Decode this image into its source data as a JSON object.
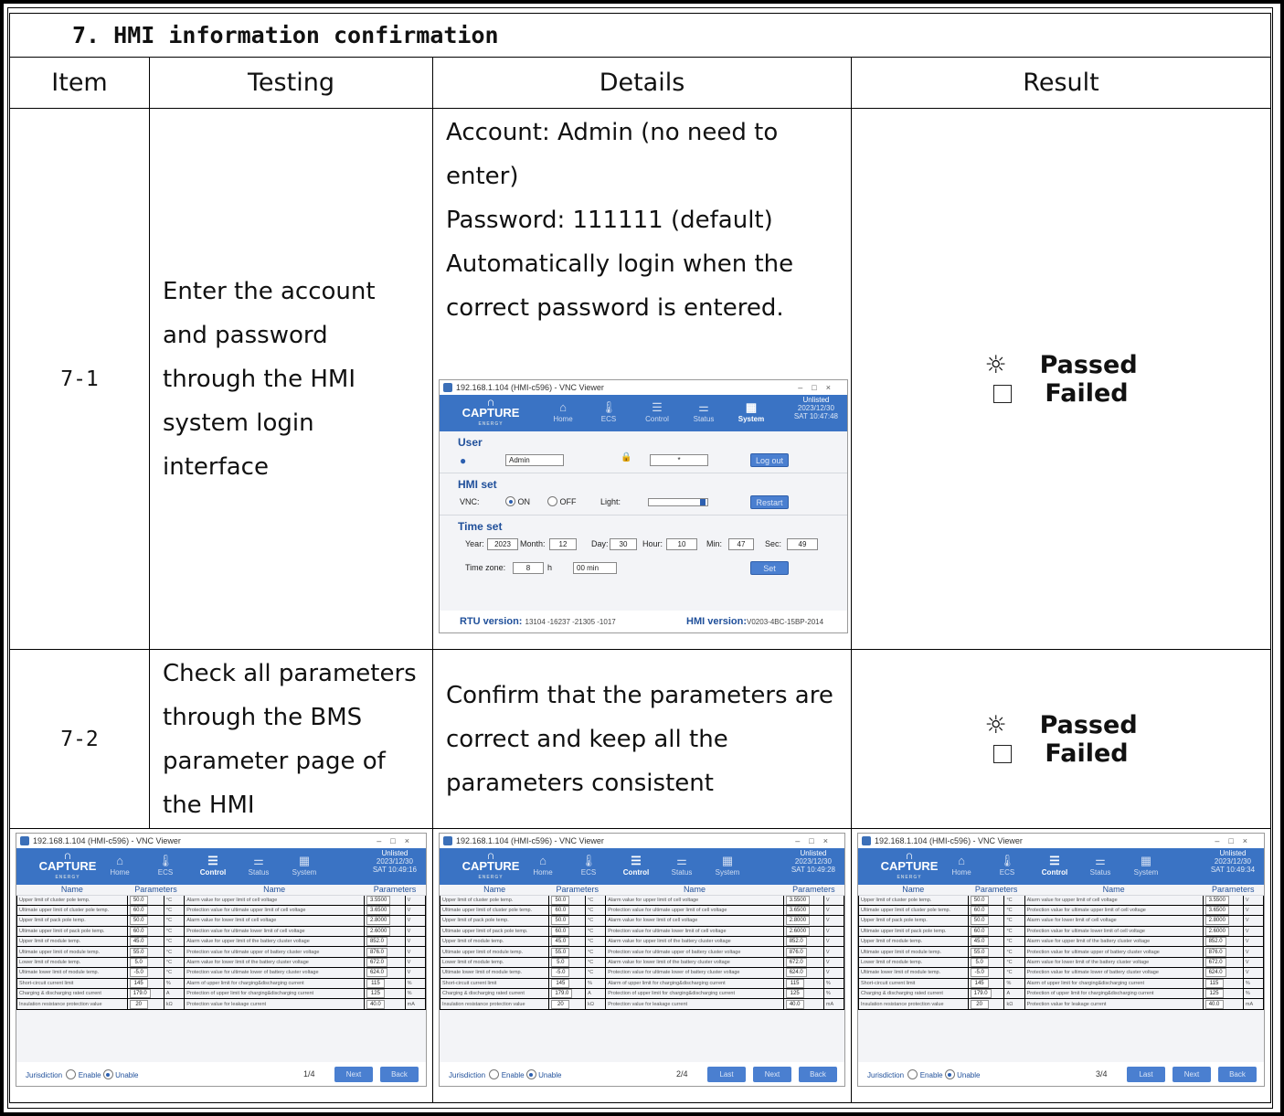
{
  "section_title": "7. HMI information confirmation",
  "headers": {
    "item": "Item",
    "testing": "Testing",
    "details": "Details",
    "result": "Result"
  },
  "rows": [
    {
      "item": "7-1",
      "testing": "Enter the account and password through the HMI system login interface",
      "details": [
        "Account: Admin (no need to",
        "enter)",
        "Password: 111111 (default)",
        "Automatically login when the",
        "correct password is entered."
      ],
      "passed": "Passed",
      "failed": "Failed"
    },
    {
      "item": "7-2",
      "testing": "Check all parameters through the BMS parameter page of the HMI",
      "details": [
        "Confirm that the parameters are",
        "correct and keep all the",
        "parameters consistent"
      ],
      "passed": "Passed",
      "failed": "Failed"
    }
  ],
  "vnc": {
    "window_title": "192.168.1.104 (HMI-c596) - VNC Viewer",
    "logo": "CAPTURE",
    "logo_sub": "ENERGY",
    "nav": [
      "Home",
      "ECS",
      "Control",
      "Status",
      "System"
    ],
    "login_screen": {
      "status": "Unlisted",
      "date": "2023/12/30",
      "time": "SAT  10:47:48",
      "user_heading": "User",
      "account": "Admin",
      "password_mask": "*",
      "logout": "Log out",
      "hmi_heading": "HMI set",
      "vnc_label": "VNC:",
      "on": "ON",
      "off": "OFF",
      "light": "Light:",
      "restart": "Restart",
      "time_heading": "Time set",
      "year_label": "Year:",
      "year": "2023",
      "month_label": "Month:",
      "month": "12",
      "day_label": "Day:",
      "day": "30",
      "hour_label": "Hour:",
      "hour": "10",
      "min_label": "Min:",
      "min": "47",
      "sec_label": "Sec:",
      "sec": "49",
      "tz_label": "Time zone:",
      "tz": "8",
      "tz_unit": "h",
      "tz_min": "00  min",
      "set": "Set",
      "rtu_label": "RTU version:",
      "rtu": "13104 -16237 -21305 -1017",
      "hmi_label": "HMI version:",
      "hmi": "V0203-4BC-15BP-2014"
    },
    "param_screens": [
      {
        "status": "Unlisted",
        "date": "2023/12/30",
        "time": "SAT  10:49:16",
        "page": "1/4",
        "buttons": [
          "Next",
          "Back"
        ]
      },
      {
        "status": "Unlisted",
        "date": "2023/12/30",
        "time": "SAT  10:49:28",
        "page": "2/4",
        "buttons": [
          "Last",
          "Next",
          "Back"
        ]
      },
      {
        "status": "Unlisted",
        "date": "2023/12/30",
        "time": "SAT  10:49:34",
        "page": "3/4",
        "buttons": [
          "Last",
          "Next",
          "Back"
        ]
      }
    ],
    "param_headers": [
      "Name",
      "Parameters",
      "Name",
      "Parameters"
    ],
    "jurisdiction": "Jurisdiction",
    "enable": "Enable",
    "unable": "Unable",
    "params_left": [
      [
        "Upper limit of cluster pole temp.",
        "50.0",
        "°C"
      ],
      [
        "Ultimate upper limit of cluster pole temp.",
        "60.0",
        "°C"
      ],
      [
        "Upper limit of pack pole temp.",
        "50.0",
        "°C"
      ],
      [
        "Ultimate upper limit of pack pole temp.",
        "60.0",
        "°C"
      ],
      [
        "Upper limit of module temp.",
        "45.0",
        "°C"
      ],
      [
        "Ultimate upper limit of module temp.",
        "55.0",
        "°C"
      ],
      [
        "Lower limit of module temp.",
        "5.0",
        "°C"
      ],
      [
        "Ultimate lower limit of module temp.",
        "-5.0",
        "°C"
      ],
      [
        "Short-circuit current limit",
        "145",
        "%"
      ],
      [
        "Charging & discharging rated current",
        "179.0",
        "A"
      ],
      [
        "Insulation resistance protection value",
        "20",
        "kΩ"
      ]
    ],
    "params_right": [
      [
        "Alarm value for upper limit of cell voltage",
        "3.5500",
        "V"
      ],
      [
        "Protection value for ultimate upper limit of cell voltage",
        "3.6500",
        "V"
      ],
      [
        "Alarm value for lower limit of cell voltage",
        "2.8000",
        "V"
      ],
      [
        "Protection value for ultimate lower limit of cell voltage",
        "2.6000",
        "V"
      ],
      [
        "Alarm value for upper limit of the battery cluster voltage",
        "852.0",
        "V"
      ],
      [
        "Protection value for ultimate upper of battery cluster voltage",
        "876.0",
        "V"
      ],
      [
        "Alarm value for lower limit of the battery cluster voltage",
        "672.0",
        "V"
      ],
      [
        "Protection value for ultimate lower of battery cluster voltage",
        "624.0",
        "V"
      ],
      [
        "Alarm of upper limit for charging&discharging current",
        "115",
        "%"
      ],
      [
        "Protection of upper limit for charging&discharging current",
        "125",
        "%"
      ],
      [
        "Protection value for leakage current",
        "40.0",
        "mA"
      ]
    ]
  }
}
